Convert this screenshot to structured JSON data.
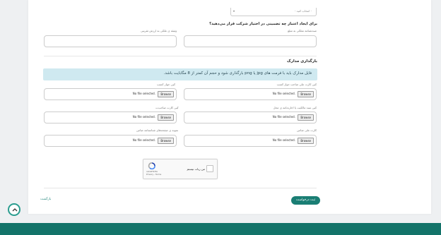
{
  "top_select": {
    "placeholder": "- انتخاب کنید -"
  },
  "question_title": "برای ایجاد اعتبار چه تضمینی در اختیار شرکت قرار می‌دهید؟",
  "guarantee": {
    "right_label": "صندشنامه تملکی به مبلغ",
    "left_label": "وثیقه ی ملکی به ارزش تقریبی"
  },
  "documents": {
    "title": "بارگذاری مدارک",
    "info": "فایل مدارک باید با فرمت های jpg یا png بارگذاری شود و حجم آن کمتر از 8 مگابایت باشد.",
    "file_button": "Browse",
    "no_file_text": "No file selected.",
    "fields": [
      {
        "label": "کپی کارت ملی صاحب جواز کسب"
      },
      {
        "label": "کپی جواز کسب"
      },
      {
        "label": "کپی سند مالکیت یا اجاره‌نامه ی محل"
      },
      {
        "label": "کپی کارت صاحب‌ت"
      },
      {
        "label": "کارت ملی ضامن"
      },
      {
        "label": "نمونه ی صفحه‌های شناسنامه ضامن"
      }
    ]
  },
  "captcha": {
    "label": "من ربات نیستم",
    "brand": "reCAPTCHA",
    "terms": "Privacy - Terms"
  },
  "submit_label": "ثبت درخواست",
  "back_label": "بازگشت",
  "colors": {
    "accent": "#1a7e74",
    "info_bg": "#cfe9f0",
    "footer": "#137369"
  }
}
